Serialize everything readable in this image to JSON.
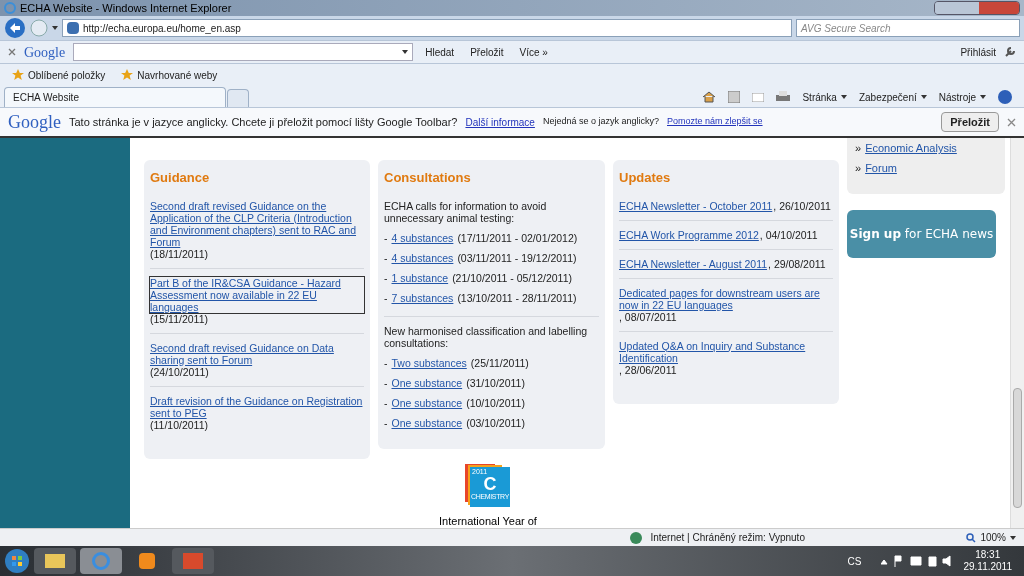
{
  "window": {
    "title": "ECHA Website - Windows Internet Explorer"
  },
  "address_bar": {
    "url": "http://echa.europa.eu/home_en.asp",
    "search_placeholder": "AVG Secure Search"
  },
  "google_toolbar": {
    "brand": "Google",
    "buttons": [
      "Hledat",
      "Přeložit",
      "Více »"
    ],
    "sign_in": "Přihlásit"
  },
  "favorites_bar": [
    "Oblíbené položky",
    "Navrhované weby"
  ],
  "tabs": [
    {
      "label": "ECHA Website",
      "selected": true
    }
  ],
  "command_bar": [
    "Stránka",
    "Zabezpečení",
    "Nástroje"
  ],
  "translate_bar": {
    "brand": "Google",
    "message": "Tato stránka je v jazyce anglicky. Chcete ji přeložit pomocí lišty Google Toolbar?",
    "more_link": "Další informace",
    "note": "Nejedná se o jazyk anglicky?",
    "help_link": "Pomozte nám zlepšit se",
    "button": "Přeložit"
  },
  "guidance": {
    "title": "Guidance",
    "items": [
      {
        "link": "Second draft revised Guidance on the Application of the CLP Criteria (Introduction and Environment chapters) sent to RAC and Forum",
        "date": "(18/11/2011)",
        "focused": false
      },
      {
        "link": "Part B of the IR&CSA Guidance - Hazard Assessment now available in 22 EU languages",
        "date": "(15/11/2011)",
        "focused": true
      },
      {
        "link": "Second draft revised Guidance on Data sharing sent to Forum",
        "date": "(24/10/2011)",
        "focused": false
      },
      {
        "link": "Draft revision of the Guidance on Registration sent to PEG",
        "date": "(11/10/2011)",
        "focused": false
      }
    ]
  },
  "consultations": {
    "title": "Consultations",
    "sections": [
      {
        "intro": "ECHA calls for information to avoid unnecessary animal testing:",
        "items": [
          {
            "bullet": "-",
            "link": "4 substances",
            "period": "(17/11/2011 - 02/01/2012)"
          },
          {
            "bullet": "-",
            "link": "4 substances",
            "period": "(03/11/2011 - 19/12/2011)"
          },
          {
            "bullet": "-",
            "link": "1 substance",
            "period": "(21/10/2011 - 05/12/2011)"
          },
          {
            "bullet": "-",
            "link": "7 substances",
            "period": "(13/10/2011 - 28/11/2011)"
          }
        ]
      },
      {
        "intro": "New harmonised classification and labelling consultations:",
        "items": [
          {
            "bullet": "-",
            "link": "Two substances",
            "period": "(25/11/2011)"
          },
          {
            "bullet": "-",
            "link": "One substance",
            "period": "(31/10/2011)"
          },
          {
            "bullet": "-",
            "link": "One substance",
            "period": "(10/10/2011)"
          },
          {
            "bullet": "-",
            "link": "One substance",
            "period": "(03/10/2011)"
          }
        ]
      }
    ]
  },
  "updates": {
    "title": "Updates",
    "items": [
      {
        "link": "ECHA Newsletter - October 2011",
        "date": ", 26/10/2011"
      },
      {
        "link": "ECHA Work Programme 2012",
        "date": ", 04/10/2011"
      },
      {
        "link": "ECHA Newsletter - August 2011",
        "date": ", 29/08/2011"
      },
      {
        "link": "Dedicated pages for downstream users are now in 22 EU languages",
        "date": ", 08/07/2011"
      },
      {
        "link": "Updated Q&A on Inquiry and Substance Identification",
        "date": ", 28/06/2011"
      }
    ]
  },
  "sidebar_links": [
    {
      "bullet": "»",
      "link": "Economic Analysis"
    },
    {
      "bullet": "»",
      "link": "Forum"
    }
  ],
  "signup_banner": "**Sign up** for ECHA news",
  "logo": {
    "year": "2011",
    "letter": "C",
    "word": "CHEMISTRY",
    "caption": "International Year of"
  },
  "status_bar": {
    "zone": "Internet | Chráněný režim: Vypnuto",
    "zoom": "100%"
  },
  "taskbar": {
    "language": "CS",
    "time": "18:31",
    "date": "29.11.2011"
  }
}
